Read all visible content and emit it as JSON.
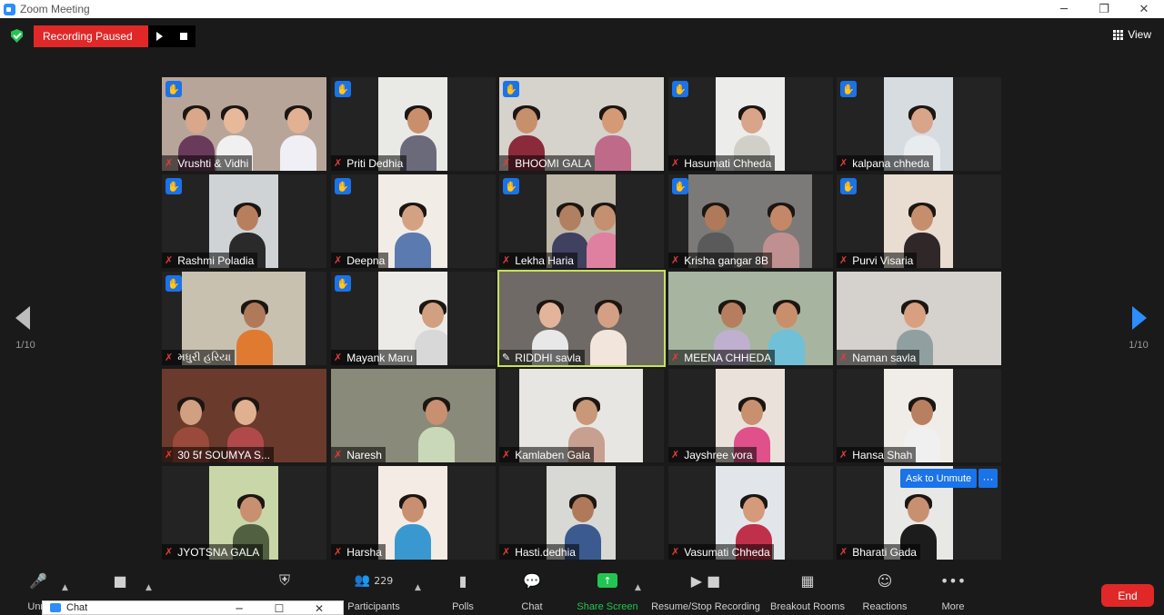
{
  "window": {
    "title": "Zoom Meeting",
    "minimize": "─",
    "maximize": "❐",
    "close": "✕"
  },
  "recording": {
    "status": "Recording Paused"
  },
  "view": {
    "label": "View"
  },
  "pager": {
    "left": "1/10",
    "right": "1/10"
  },
  "tiles": [
    {
      "name": "Vrushti & Vidhi",
      "hand": true
    },
    {
      "name": "Priti Dedhia",
      "hand": true
    },
    {
      "name": "BHOOMI GALA",
      "hand": true
    },
    {
      "name": "Hasumati Chheda",
      "hand": true
    },
    {
      "name": "kalpana chheda",
      "hand": true
    },
    {
      "name": "Rashmi Poladia",
      "hand": true
    },
    {
      "name": "Deepna",
      "hand": true
    },
    {
      "name": "Lekha Haria",
      "hand": true
    },
    {
      "name": "Krisha gangar 8B",
      "hand": true
    },
    {
      "name": "Purvi Visaria",
      "hand": true
    },
    {
      "name": "મધુરી હરિયા",
      "hand": true
    },
    {
      "name": "Mayank Maru",
      "hand": true
    },
    {
      "name": "RIDDHI savla",
      "hand": false
    },
    {
      "name": "MEENA  CHHEDA",
      "hand": false
    },
    {
      "name": "Naman savla",
      "hand": false
    },
    {
      "name": "30 5f SOUMYA S...",
      "hand": false
    },
    {
      "name": "Naresh",
      "hand": false
    },
    {
      "name": "Kamlaben Gala",
      "hand": false
    },
    {
      "name": "Jayshree vora",
      "hand": false
    },
    {
      "name": "Hansa Shah",
      "hand": false
    },
    {
      "name": "JYOTSNA GALA",
      "hand": false
    },
    {
      "name": "Harsha",
      "hand": false
    },
    {
      "name": "Hasti.dedhia",
      "hand": false
    },
    {
      "name": "Vasumati Chheda",
      "hand": false
    },
    {
      "name": "Bharati Gada",
      "hand": false
    }
  ],
  "hover": {
    "ask_unmute": "Ask to Unmute",
    "more": "···"
  },
  "toolbar": {
    "unmute": "Unm",
    "participants_count": "229",
    "participants": "Participants",
    "polls": "Polls",
    "chat": "Chat",
    "share_screen": "Share Screen",
    "recording": "Resume/Stop Recording",
    "breakout": "Breakout Rooms",
    "reactions": "Reactions",
    "more": "More",
    "end": "End"
  },
  "chat_window": {
    "title": "Chat"
  },
  "colors": {
    "accent": "#2d8cff",
    "record_red": "#e02828",
    "share_green": "#23c552",
    "hand_blue": "#1a73e8",
    "active_speaker": "#c6e35a"
  }
}
